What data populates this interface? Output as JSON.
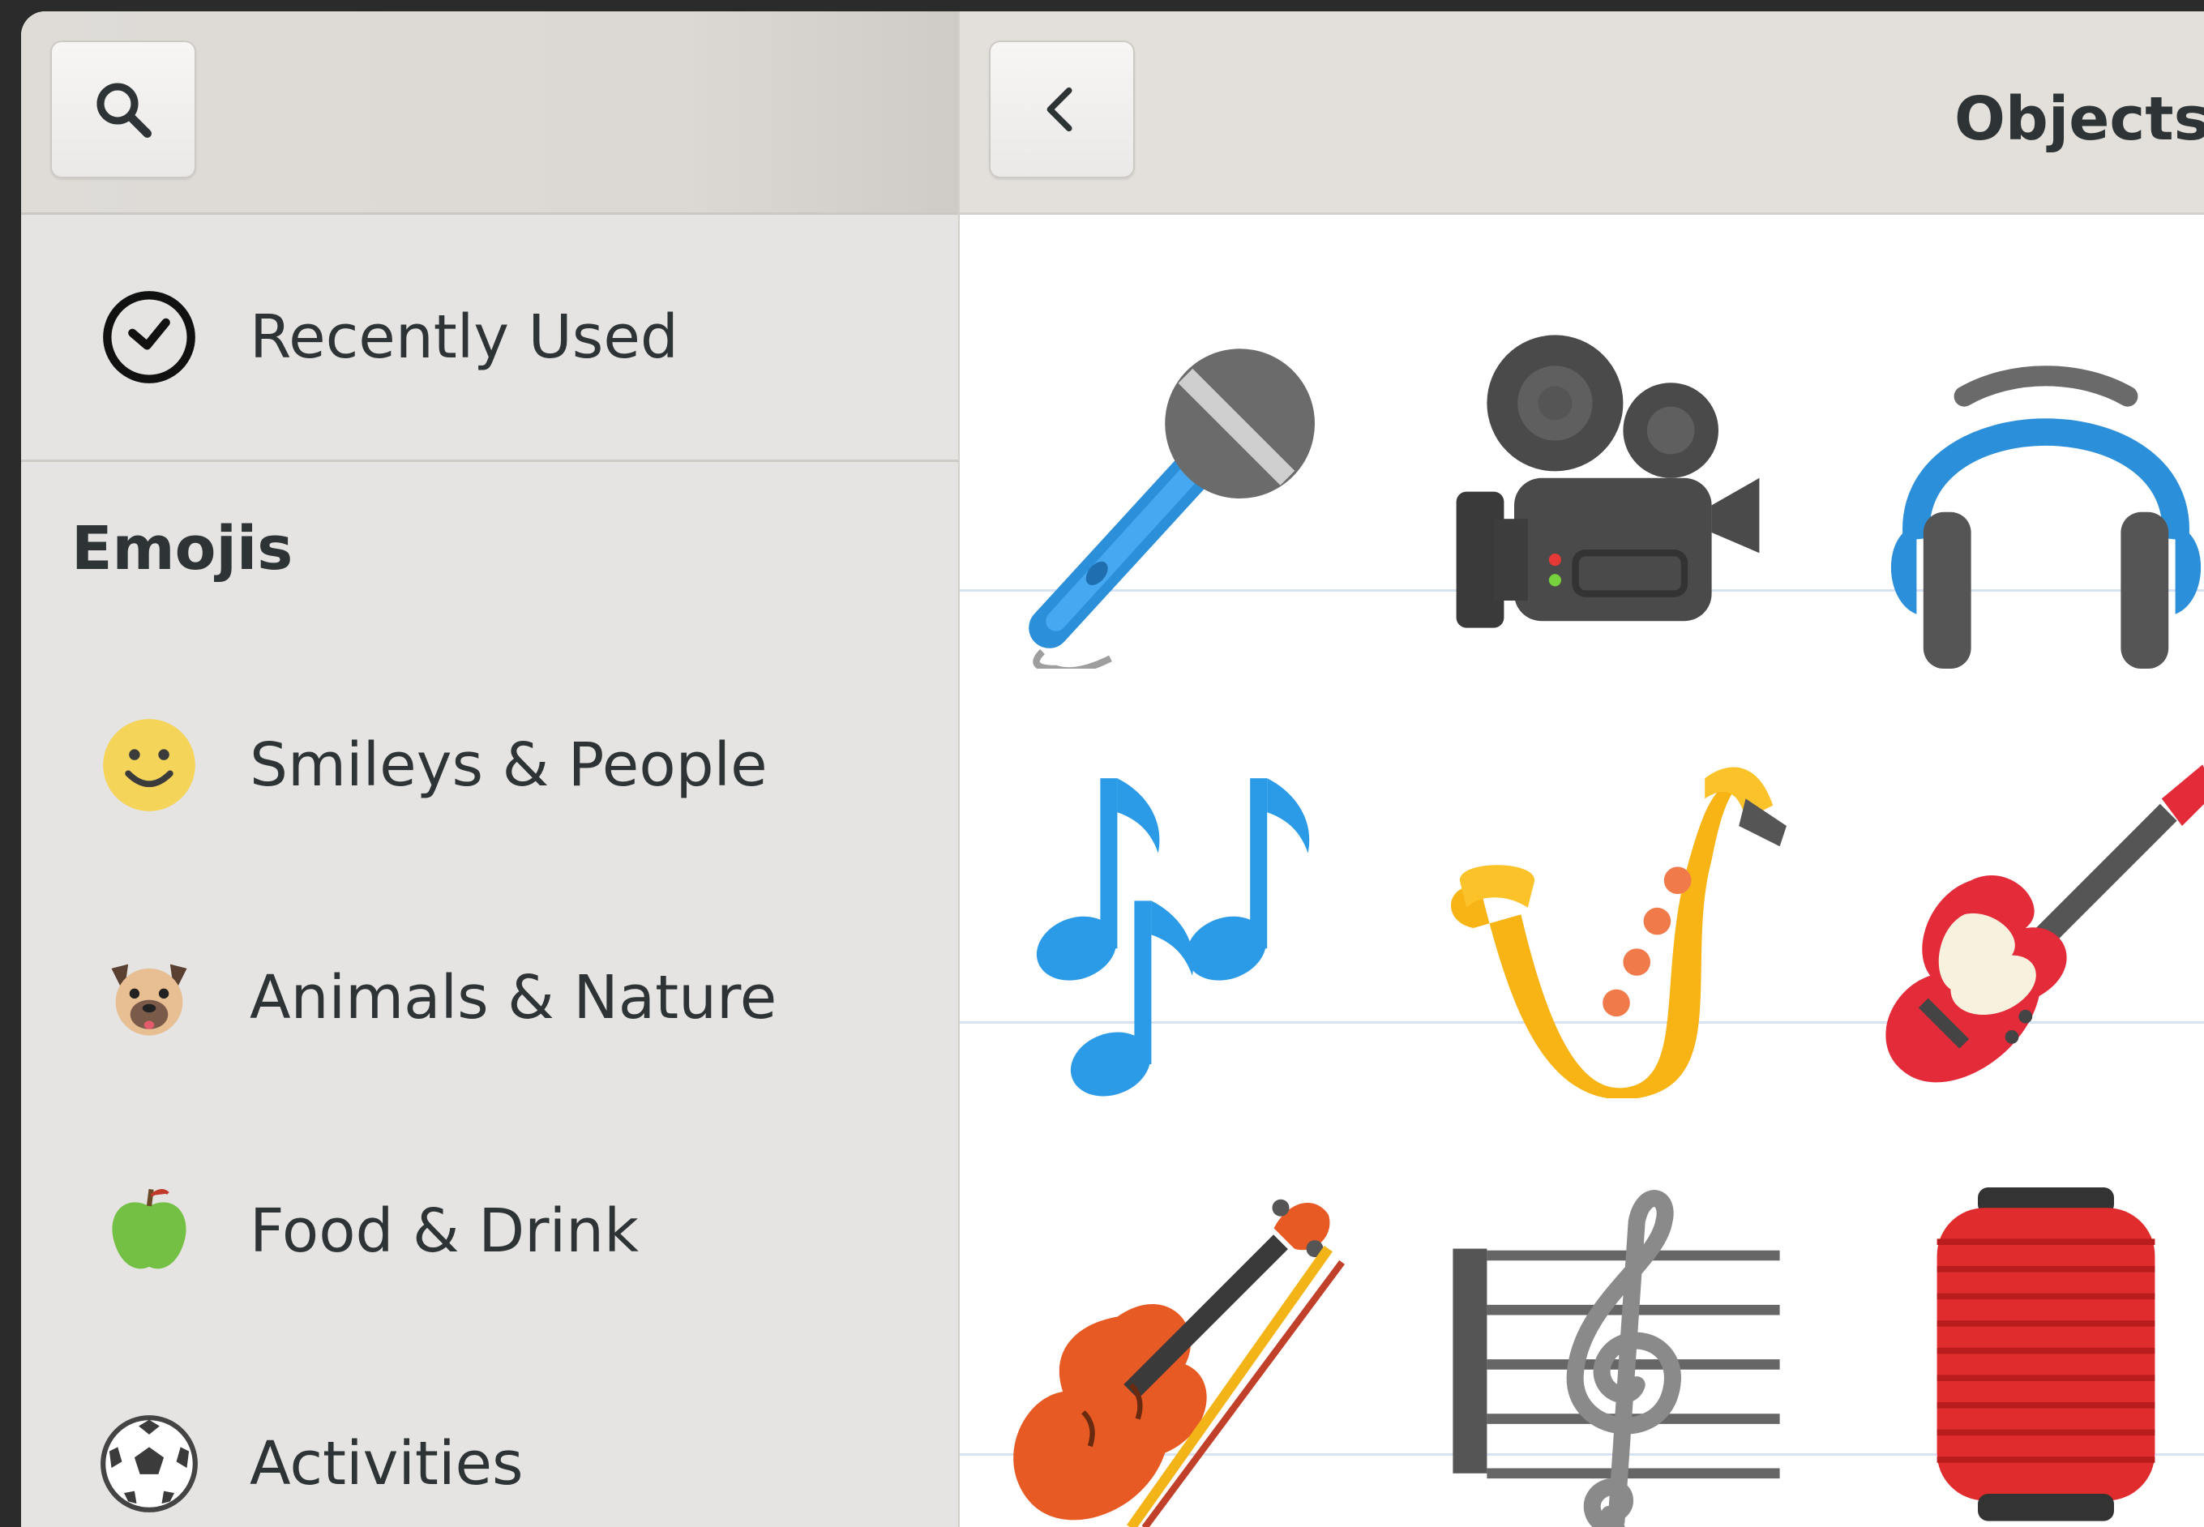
{
  "sidebar": {
    "search_icon": "search-icon",
    "recent": {
      "label": "Recently Used",
      "icon": "clock-icon"
    },
    "section_title": "Emojis",
    "categories": [
      {
        "label": "Smileys & People",
        "icon": "smiley-icon"
      },
      {
        "label": "Animals & Nature",
        "icon": "dog-face-icon"
      },
      {
        "label": "Food & Drink",
        "icon": "green-apple-icon"
      },
      {
        "label": "Activities",
        "icon": "soccer-ball-icon"
      }
    ]
  },
  "header": {
    "back_icon": "chevron-left-icon",
    "title": "Objects"
  },
  "emojis": [
    {
      "name": "microphone"
    },
    {
      "name": "movie-camera"
    },
    {
      "name": "headphones"
    },
    {
      "name": "musical-notes"
    },
    {
      "name": "saxophone"
    },
    {
      "name": "guitar"
    },
    {
      "name": "violin"
    },
    {
      "name": "musical-score"
    },
    {
      "name": "red-lantern"
    }
  ],
  "colors": {
    "sidebar_bg": "#e6e4e2",
    "header_bg": "#e3e0dc",
    "grid_line": "#d7e2f2",
    "text": "#2e3436"
  }
}
